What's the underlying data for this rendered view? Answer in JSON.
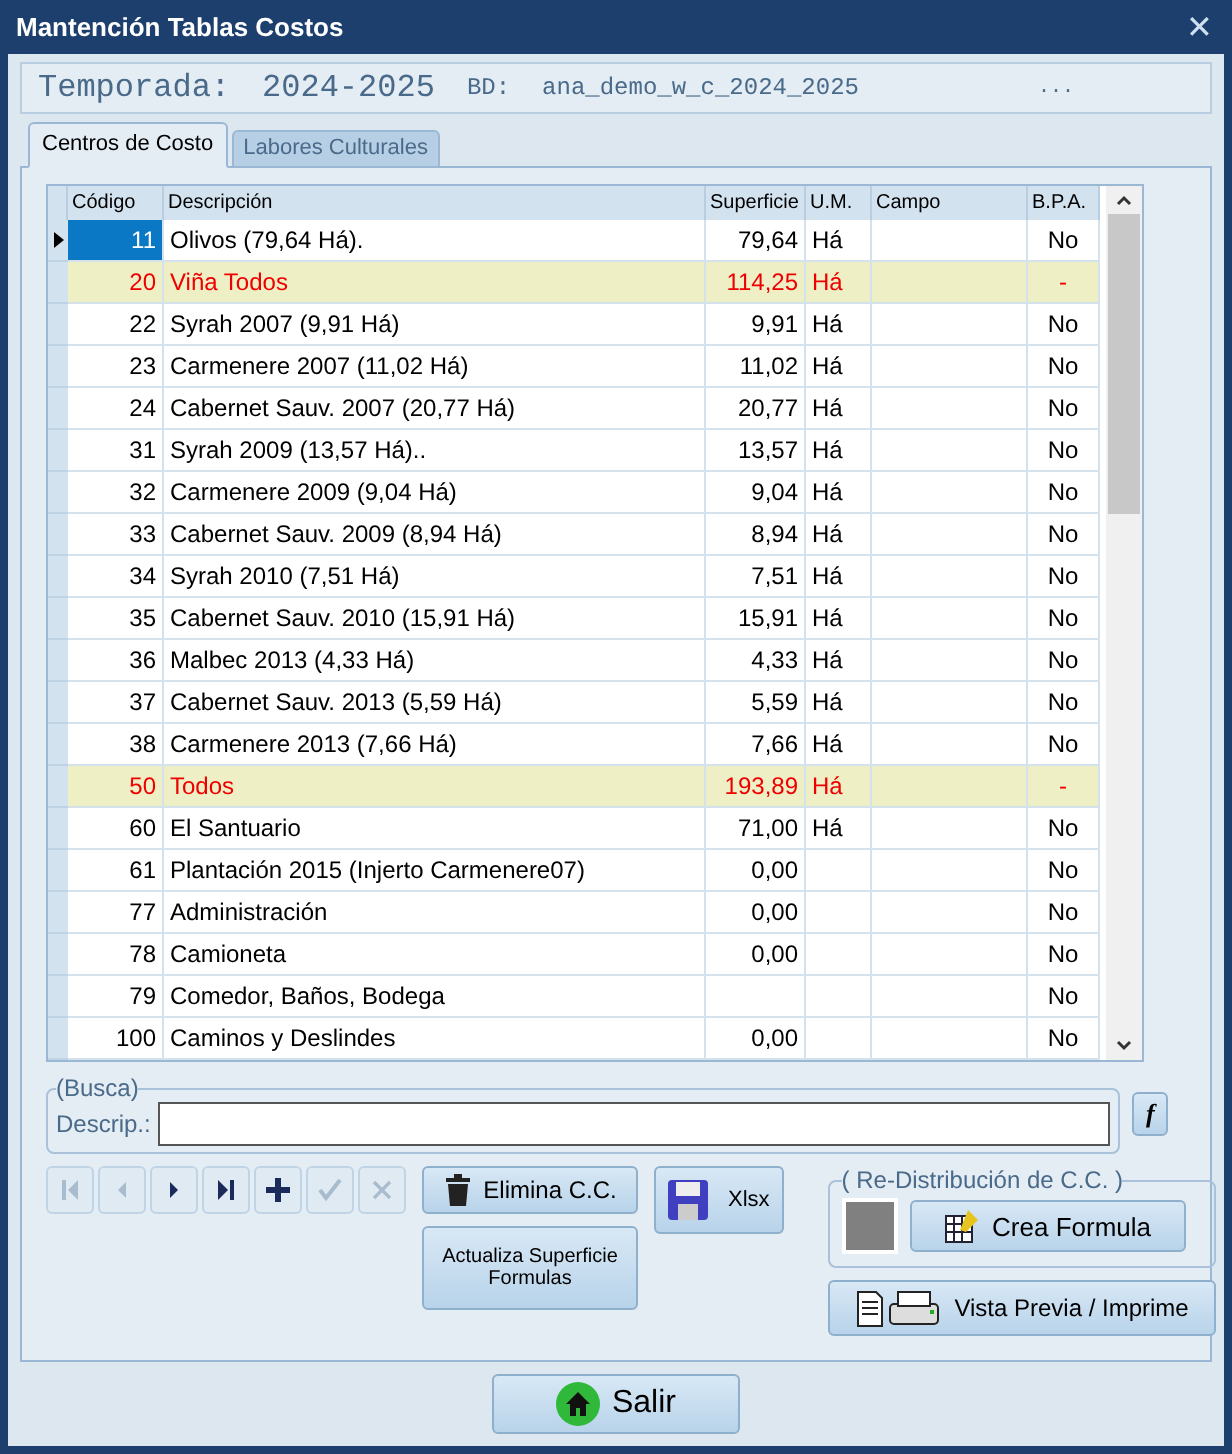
{
  "window": {
    "title": "Mantención Tablas Costos",
    "close": "✕"
  },
  "info": {
    "season_label": "Temporada:",
    "season": "2024-2025",
    "db_label": "BD:",
    "db": "ana_demo_w_c_2024_2025",
    "more": "..."
  },
  "tabs": [
    {
      "label": "Centros de Costo",
      "selected": true
    },
    {
      "label": "Labores Culturales",
      "selected": false
    }
  ],
  "table": {
    "columns": [
      "Código",
      "Descripción",
      "Superficie",
      "U.M.",
      "Campo",
      "B.P.A."
    ],
    "rows": [
      {
        "kind": "normal",
        "selected": true,
        "cells": [
          "11",
          "Olivos  (79,64 Há).",
          "79,64",
          "Há",
          "",
          "No"
        ]
      },
      {
        "kind": "group",
        "selected": false,
        "cells": [
          "20",
          "Viña Todos",
          "114,25",
          "Há",
          "",
          "-"
        ]
      },
      {
        "kind": "normal",
        "selected": false,
        "cells": [
          "22",
          "Syrah 2007 (9,91 Há)",
          "9,91",
          "Há",
          "",
          "No"
        ]
      },
      {
        "kind": "normal",
        "selected": false,
        "cells": [
          "23",
          "Carmenere 2007 (11,02 Há)",
          "11,02",
          "Há",
          "",
          "No"
        ]
      },
      {
        "kind": "normal",
        "selected": false,
        "cells": [
          "24",
          "Cabernet Sauv. 2007 (20,77 Há)",
          "20,77",
          "Há",
          "",
          "No"
        ]
      },
      {
        "kind": "normal",
        "selected": false,
        "cells": [
          "31",
          "Syrah 2009 (13,57 Há)..",
          "13,57",
          "Há",
          "",
          "No"
        ]
      },
      {
        "kind": "normal",
        "selected": false,
        "cells": [
          "32",
          "Carmenere 2009 (9,04 Há)",
          "9,04",
          "Há",
          "",
          "No"
        ]
      },
      {
        "kind": "normal",
        "selected": false,
        "cells": [
          "33",
          "Cabernet Sauv. 2009 (8,94 Há)",
          "8,94",
          "Há",
          "",
          "No"
        ]
      },
      {
        "kind": "normal",
        "selected": false,
        "cells": [
          "34",
          "Syrah 2010 (7,51 Há)",
          "7,51",
          "Há",
          "",
          "No"
        ]
      },
      {
        "kind": "normal",
        "selected": false,
        "cells": [
          "35",
          "Cabernet Sauv. 2010 (15,91 Há)",
          "15,91",
          "Há",
          "",
          "No"
        ]
      },
      {
        "kind": "normal",
        "selected": false,
        "cells": [
          "36",
          "Malbec 2013 (4,33 Há)",
          "4,33",
          "Há",
          "",
          "No"
        ]
      },
      {
        "kind": "normal",
        "selected": false,
        "cells": [
          "37",
          "Cabernet Sauv. 2013 (5,59 Há)",
          "5,59",
          "Há",
          "",
          "No"
        ]
      },
      {
        "kind": "normal",
        "selected": false,
        "cells": [
          "38",
          "Carmenere 2013 (7,66 Há)",
          "7,66",
          "Há",
          "",
          "No"
        ]
      },
      {
        "kind": "group",
        "selected": false,
        "cells": [
          "50",
          "Todos",
          "193,89",
          "Há",
          "",
          "-"
        ]
      },
      {
        "kind": "normal",
        "selected": false,
        "cells": [
          "60",
          "El Santuario",
          "71,00",
          "Há",
          "",
          "No"
        ]
      },
      {
        "kind": "normal",
        "selected": false,
        "cells": [
          "61",
          "Plantación 2015 (Injerto Carmenere07)",
          "0,00",
          "",
          "",
          "No"
        ]
      },
      {
        "kind": "normal",
        "selected": false,
        "cells": [
          "77",
          "Administración",
          "0,00",
          "",
          "",
          "No"
        ]
      },
      {
        "kind": "normal",
        "selected": false,
        "cells": [
          "78",
          "Camioneta",
          "0,00",
          "",
          "",
          "No"
        ]
      },
      {
        "kind": "normal",
        "selected": false,
        "cells": [
          "79",
          "Comedor, Baños, Bodega",
          "",
          "",
          "",
          "No"
        ]
      },
      {
        "kind": "normal",
        "selected": false,
        "cells": [
          "100",
          "Caminos y Deslindes",
          "0,00",
          "",
          "",
          "No"
        ]
      }
    ]
  },
  "search": {
    "legend": "(Busca)",
    "label": "Descrip.:",
    "formula_button": "f"
  },
  "navigator": [
    {
      "kind": "first",
      "disabled": true
    },
    {
      "kind": "prev",
      "disabled": true
    },
    {
      "kind": "next",
      "disabled": false
    },
    {
      "kind": "last",
      "disabled": false
    },
    {
      "kind": "add",
      "disabled": false
    },
    {
      "kind": "post",
      "disabled": true
    },
    {
      "kind": "cancel",
      "disabled": true
    }
  ],
  "buttons": {
    "delete": "Elimina C.C.",
    "update": "Actualiza  Superficie Formulas",
    "xlsx": "Xlsx",
    "preview": "Vista Previa / Imprime",
    "exit": "Salir"
  },
  "redistribution": {
    "legend": "( Re-Distribución de C.C. )",
    "create": "Crea Formula"
  }
}
